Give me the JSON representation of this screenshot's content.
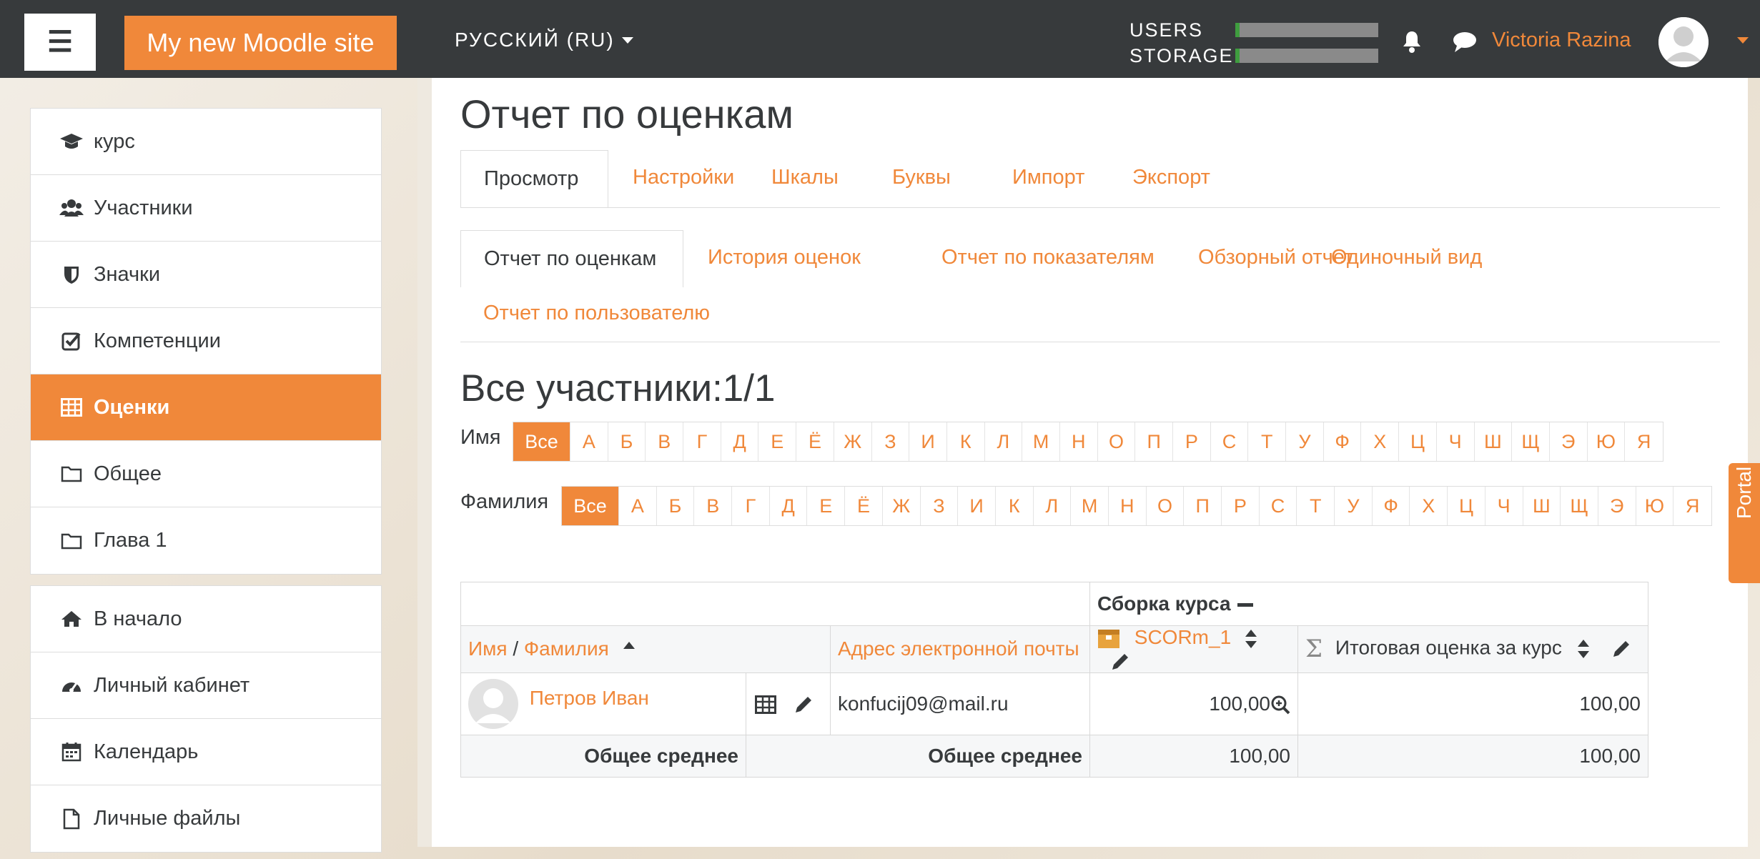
{
  "header": {
    "site_name": "My new Moodle site",
    "language": "РУССКИЙ (RU)",
    "meters": [
      {
        "label": "USERS",
        "fill_percent": 3
      },
      {
        "label": "STORAGE",
        "fill_percent": 3
      }
    ],
    "user_name": "Victoria Razina",
    "accent_color": "#f0883a"
  },
  "sidebar": {
    "items": [
      {
        "label": "курс",
        "icon": "graduation-cap-icon"
      },
      {
        "label": "Участники",
        "icon": "users-icon"
      },
      {
        "label": "Значки",
        "icon": "shield-icon"
      },
      {
        "label": "Компетенции",
        "icon": "checkbox-icon"
      },
      {
        "label": "Оценки",
        "icon": "table-icon",
        "active": true
      },
      {
        "label": "Общее",
        "icon": "folder-icon"
      },
      {
        "label": "Глава 1",
        "icon": "folder-icon"
      }
    ],
    "items2": [
      {
        "label": "В начало",
        "icon": "home-icon"
      },
      {
        "label": "Личный кабинет",
        "icon": "dashboard-icon"
      },
      {
        "label": "Календарь",
        "icon": "calendar-icon"
      },
      {
        "label": "Личные файлы",
        "icon": "file-icon"
      }
    ]
  },
  "main": {
    "title": "Отчет по оценкам",
    "tabs": [
      "Просмотр",
      "Настройки",
      "Шкалы",
      "Буквы",
      "Импорт",
      "Экспорт"
    ],
    "subtabs": [
      "Отчет по оценкам",
      "История оценок",
      "Отчет по показателям",
      "Обзорный отчет",
      "Одиночный вид",
      "Отчет по пользователю"
    ],
    "participants_heading": "Все участники:1/1",
    "firstname_label": "Имя",
    "lastname_label": "Фамилия",
    "all_label": "Все",
    "letters": [
      "А",
      "Б",
      "В",
      "Г",
      "Д",
      "Е",
      "Ё",
      "Ж",
      "З",
      "И",
      "К",
      "Л",
      "М",
      "Н",
      "О",
      "П",
      "Р",
      "С",
      "Т",
      "У",
      "Ф",
      "Х",
      "Ц",
      "Ч",
      "Ш",
      "Щ",
      "Э",
      "Ю",
      "Я"
    ],
    "table": {
      "category": "Сборка курса",
      "col_firstname": "Имя",
      "col_sep": "/",
      "col_lastname": "Фамилия",
      "col_email": "Адрес электронной почты",
      "col_item": "SCORm_1",
      "col_total": "Итоговая оценка за курс",
      "student_name": "Петров Иван",
      "student_email": "konfucij09@mail.ru",
      "student_item_grade": "100,00",
      "student_total": "100,00",
      "avg_label": "Общее среднее",
      "avg_item": "100,00",
      "avg_total": "100,00"
    }
  },
  "portal_label": "Portal"
}
